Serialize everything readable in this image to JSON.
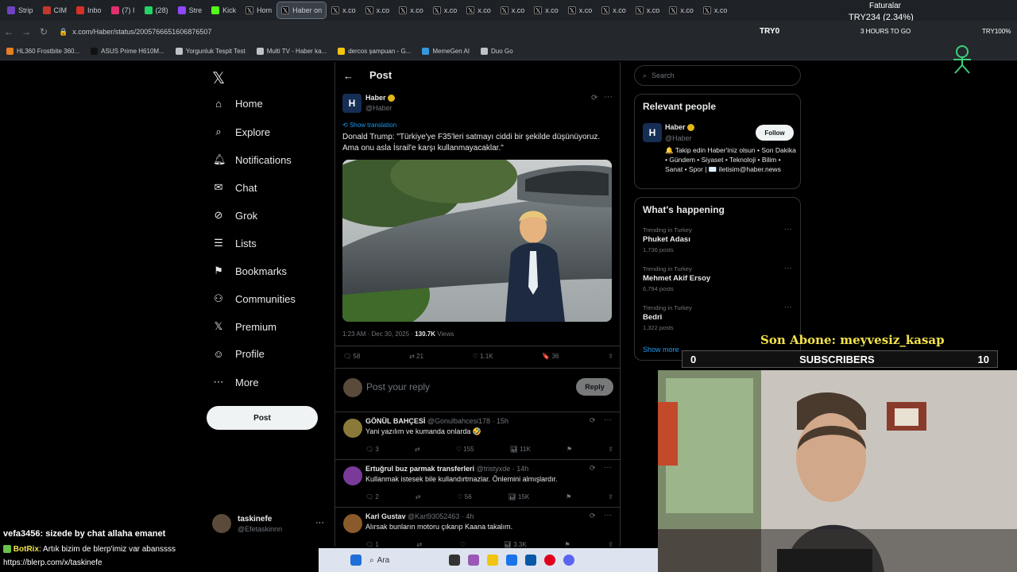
{
  "browser": {
    "tabs": [
      {
        "label": "Strip",
        "color": "#6f42c1"
      },
      {
        "label": "CIM",
        "color": "#c0392b"
      },
      {
        "label": "Inbo",
        "color": "#d93025"
      },
      {
        "label": "(7) I",
        "color": "#e1306c"
      },
      {
        "label": "(28)",
        "color": "#25d366"
      },
      {
        "label": "Stre",
        "color": "#9146ff"
      },
      {
        "label": "Kick",
        "color": "#53fc18"
      },
      {
        "label": "Hom",
        "color": "#000000"
      },
      {
        "label": "Haber on",
        "color": "#000000",
        "active": true
      },
      {
        "label": "x.co",
        "color": "#000000"
      },
      {
        "label": "x.co",
        "color": "#000000"
      },
      {
        "label": "x.co",
        "color": "#000000"
      },
      {
        "label": "x.co",
        "color": "#000000"
      },
      {
        "label": "x.co",
        "color": "#000000"
      },
      {
        "label": "x.co",
        "color": "#000000"
      },
      {
        "label": "x.co",
        "color": "#000000"
      },
      {
        "label": "x.co",
        "color": "#000000"
      },
      {
        "label": "x.co",
        "color": "#000000"
      },
      {
        "label": "x.co",
        "color": "#000000"
      },
      {
        "label": "x.co",
        "color": "#000000"
      },
      {
        "label": "x.co",
        "color": "#000000"
      }
    ],
    "url": "x.com/Haber/status/2005766651606876507",
    "ticker": "TRY234 (2.34%)",
    "ticker_top": "Faturalar",
    "addr_right": "3 HOURS TO GO",
    "addr_left_badge": "TRY0",
    "addr_right_badge": "TRY100%",
    "bookmarks": [
      {
        "label": "HL360 Frostbite 360...",
        "color": "#e67e22"
      },
      {
        "label": "ASUS Prime H610M...",
        "color": "#111111"
      },
      {
        "label": "Yorgunluk Tespit Test",
        "color": "#bdc3c7"
      },
      {
        "label": "Multi TV - Haber ka...",
        "color": "#bdc3c7"
      },
      {
        "label": "dercos şampuan - G...",
        "color": "#f1c40f"
      },
      {
        "label": "MemeGen AI",
        "color": "#3498db"
      },
      {
        "label": "Duo Go",
        "color": "#bdc3c7"
      }
    ]
  },
  "nav": {
    "items": [
      "Home",
      "Explore",
      "Notifications",
      "Chat",
      "Grok",
      "Lists",
      "Bookmarks",
      "Communities",
      "Premium",
      "Profile",
      "More"
    ],
    "icons": [
      "home-icon",
      "explore-icon",
      "bell-icon",
      "chat-icon",
      "grok-icon",
      "lists-icon",
      "bookmark-icon",
      "communities-icon",
      "x-premium-icon",
      "profile-icon",
      "more-icon"
    ],
    "post_label": "Post",
    "account_name": "taskinefe",
    "account_handle": "@Efetaskinnn"
  },
  "main": {
    "header": "Post",
    "author_name": "Haber",
    "author_handle": "@Haber",
    "show_translation": "Show translation",
    "text": "Donald Trump: \"Türkiye'ye F35'leri satmayı ciddi bir şekilde düşünüyoruz. Ama onu asla İsrail'e karşı kullanmayacaklar.\"",
    "meta_time": "1:23 AM · Dec 30, 2025 · ",
    "meta_views": "130.7K",
    "meta_views_label": " Views",
    "stats": {
      "replies": "58",
      "reposts": "21",
      "likes": "1.1K",
      "bookmarks": "36"
    },
    "reply_placeholder": "Post your reply",
    "reply_button": "Reply",
    "replies": [
      {
        "name": "GÖNÜL BAHÇESİ",
        "handle": "@Gonulbahcesi178 · 15h",
        "text": "Yani yazılım ve kumanda onlarda 🤣",
        "replies": "3",
        "reposts": "",
        "likes": "155",
        "views": "11K",
        "avatar_color": "#8a7a3a"
      },
      {
        "name": "Ertuğrul buz parmak transferleri",
        "handle": "@tristyxde · 14h",
        "text": "Kullanmak istesek bile kullandırtmazlar. Önlemini almışlardır.",
        "replies": "2",
        "reposts": "",
        "likes": "56",
        "views": "15K",
        "avatar_color": "#7a3a9a"
      },
      {
        "name": "Karl Gustav",
        "handle": "@Karl93052463 · 4h",
        "text": "Alırsak bunların motoru çıkarıp Kaana takalım.",
        "replies": "1",
        "reposts": "",
        "likes": "",
        "views": "3.3K",
        "avatar_color": "#8a5a2a"
      }
    ]
  },
  "right": {
    "search_placeholder": "Search",
    "relevant_title": "Relevant people",
    "person_name": "Haber",
    "person_handle": "@Haber",
    "follow_label": "Follow",
    "person_bio": "🔔 Takip edin Haber'iniz olsun • Son Dakika • Gündem • Siyaset • Teknoloji • Bilim • Sanat • Spor | ✉️ iletisim@haber.news",
    "happening_title": "What's happening",
    "trends": [
      {
        "context": "Trending in Turkey",
        "name": "Phuket Adası",
        "count": "1,736 posts"
      },
      {
        "context": "Trending in Turkey",
        "name": "Mehmet Akif Ersoy",
        "count": "6,794 posts"
      },
      {
        "context": "Trending in Turkey",
        "name": "Bedri",
        "count": "1,322 posts"
      }
    ],
    "show_more": "Show more"
  },
  "overlay": {
    "sub_title": "Son Abone: meyvesiz_kasap",
    "sub_left": "0",
    "sub_label": "SUBSCRIBERS",
    "sub_right": "10",
    "chat1_user": "vefa3456",
    "chat1_text": ": sizede by chat allaha emanet",
    "chat2_user": "BotRix",
    "chat2_text": ": Artık bizim de blerp'imiz var abanssss",
    "chat3_text": "https://blerp.com/x/taskinefe",
    "search_label": "Ara"
  }
}
